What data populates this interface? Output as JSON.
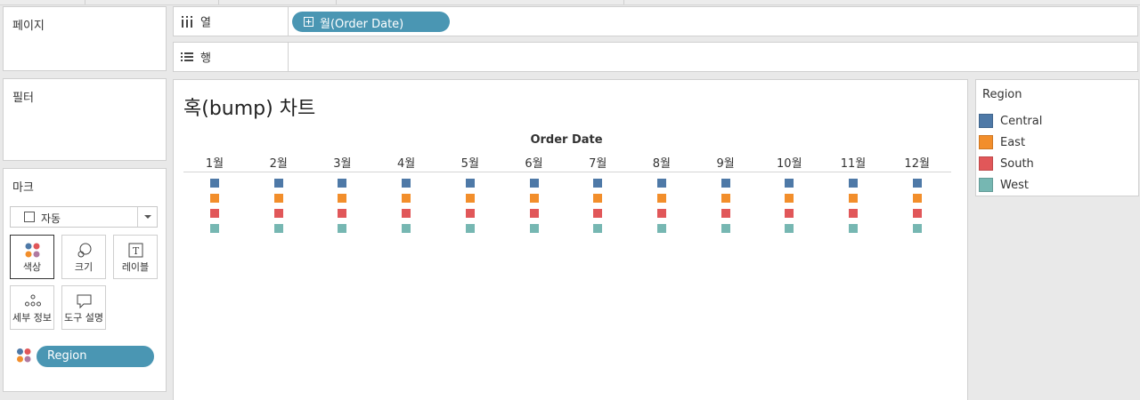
{
  "panels": {
    "pages": "페이지",
    "filters": "필터",
    "marks": "마크"
  },
  "shelves": {
    "columns": {
      "label": "열",
      "pill": "월(Order Date)",
      "pill_icon": "plus-box-icon"
    },
    "rows": {
      "label": "행"
    }
  },
  "marks_card": {
    "mark_type": "자동",
    "buttons": {
      "color": "색상",
      "size": "크기",
      "label": "레이블",
      "detail": "세부 정보",
      "tooltip": "도구 설명"
    },
    "region_pill": "Region"
  },
  "chart": {
    "title": "혹(bump) 차트",
    "axis_title": "Order Date"
  },
  "chart_data": {
    "type": "scatter",
    "title": "혹(bump) 차트",
    "xlabel": "Order Date",
    "ylabel": "",
    "categories": [
      "1월",
      "2월",
      "3월",
      "4월",
      "5월",
      "6월",
      "7월",
      "8월",
      "9월",
      "10월",
      "11월",
      "12월"
    ],
    "series": [
      {
        "name": "Central",
        "color": "#4e79a7",
        "rank": [
          1,
          1,
          1,
          1,
          1,
          1,
          1,
          1,
          1,
          1,
          1,
          1
        ]
      },
      {
        "name": "East",
        "color": "#f28e2b",
        "rank": [
          2,
          2,
          2,
          2,
          2,
          2,
          2,
          2,
          2,
          2,
          2,
          2
        ]
      },
      {
        "name": "South",
        "color": "#e15759",
        "rank": [
          3,
          3,
          3,
          3,
          3,
          3,
          3,
          3,
          3,
          3,
          3,
          3
        ]
      },
      {
        "name": "West",
        "color": "#76b7b2",
        "rank": [
          4,
          4,
          4,
          4,
          4,
          4,
          4,
          4,
          4,
          4,
          4,
          4
        ]
      }
    ],
    "legend": "right"
  },
  "legend": {
    "title": "Region",
    "items": [
      {
        "label": "Central",
        "color": "#4e79a7"
      },
      {
        "label": "East",
        "color": "#f28e2b"
      },
      {
        "label": "South",
        "color": "#e15759"
      },
      {
        "label": "West",
        "color": "#76b7b2"
      }
    ]
  }
}
